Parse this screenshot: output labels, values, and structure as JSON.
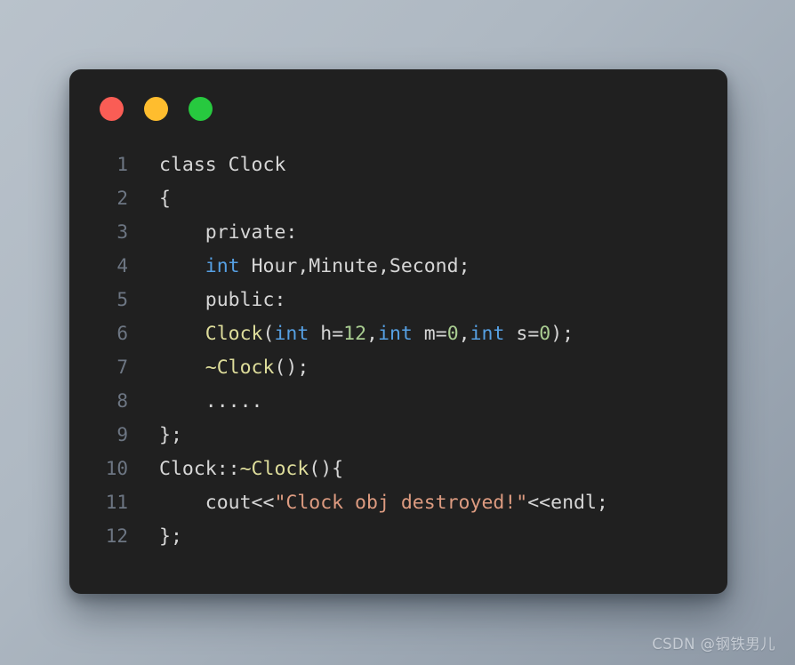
{
  "window": {
    "background_color": "#202020",
    "corner_radius_px": 13,
    "traffic_lights": [
      {
        "name": "close",
        "color": "#fa5d55"
      },
      {
        "name": "minimize",
        "color": "#ffbd2e"
      },
      {
        "name": "maximize",
        "color": "#27c93f"
      }
    ]
  },
  "theme": {
    "page_background_start": "#b9c2cb",
    "page_background_end": "#8e99a6",
    "default_text": "#d6d6d6",
    "line_number": "#6d7683",
    "keyword": "#56a0e3",
    "type": "#dedd9b",
    "number": "#a9cd91",
    "string": "#dd9b80"
  },
  "code": {
    "language": "cpp",
    "lines": [
      {
        "number": "1",
        "text": "class Clock",
        "tokens": [
          {
            "t": "class Clock",
            "c": "default"
          }
        ]
      },
      {
        "number": "2",
        "text": "{",
        "tokens": [
          {
            "t": "{",
            "c": "default"
          }
        ]
      },
      {
        "number": "3",
        "text": "    private:",
        "tokens": [
          {
            "t": "    private:",
            "c": "default"
          }
        ]
      },
      {
        "number": "4",
        "text": "    int Hour,Minute,Second;",
        "tokens": [
          {
            "t": "    ",
            "c": "default"
          },
          {
            "t": "int",
            "c": "keyword"
          },
          {
            "t": " Hour,Minute,Second;",
            "c": "default"
          }
        ]
      },
      {
        "number": "5",
        "text": "    public:",
        "tokens": [
          {
            "t": "    public:",
            "c": "default"
          }
        ]
      },
      {
        "number": "6",
        "text": "    Clock(int h=12,int m=0,int s=0);",
        "tokens": [
          {
            "t": "    ",
            "c": "default"
          },
          {
            "t": "Clock",
            "c": "type"
          },
          {
            "t": "(",
            "c": "default"
          },
          {
            "t": "int",
            "c": "keyword"
          },
          {
            "t": " h=",
            "c": "default"
          },
          {
            "t": "12",
            "c": "number"
          },
          {
            "t": ",",
            "c": "default"
          },
          {
            "t": "int",
            "c": "keyword"
          },
          {
            "t": " m=",
            "c": "default"
          },
          {
            "t": "0",
            "c": "number"
          },
          {
            "t": ",",
            "c": "default"
          },
          {
            "t": "int",
            "c": "keyword"
          },
          {
            "t": " s=",
            "c": "default"
          },
          {
            "t": "0",
            "c": "number"
          },
          {
            "t": ");",
            "c": "default"
          }
        ]
      },
      {
        "number": "7",
        "text": "    ~Clock();",
        "tokens": [
          {
            "t": "    ",
            "c": "default"
          },
          {
            "t": "~Clock",
            "c": "type"
          },
          {
            "t": "();",
            "c": "default"
          }
        ]
      },
      {
        "number": "8",
        "text": "    .....",
        "tokens": [
          {
            "t": "    .....",
            "c": "default"
          }
        ]
      },
      {
        "number": "9",
        "text": "};",
        "tokens": [
          {
            "t": "};",
            "c": "default"
          }
        ]
      },
      {
        "number": "10",
        "text": "Clock::~Clock(){",
        "tokens": [
          {
            "t": "Clock::",
            "c": "default"
          },
          {
            "t": "~Clock",
            "c": "type"
          },
          {
            "t": "(){",
            "c": "default"
          }
        ]
      },
      {
        "number": "11",
        "text": "    cout<<\"Clock obj destroyed!\"<<endl;",
        "tokens": [
          {
            "t": "    cout<<",
            "c": "default"
          },
          {
            "t": "\"Clock obj destroyed!\"",
            "c": "string"
          },
          {
            "t": "<<endl;",
            "c": "default"
          }
        ]
      },
      {
        "number": "12",
        "text": "};",
        "tokens": [
          {
            "t": "};",
            "c": "default"
          }
        ]
      }
    ]
  },
  "watermark": {
    "text": "CSDN @钢铁男儿"
  }
}
